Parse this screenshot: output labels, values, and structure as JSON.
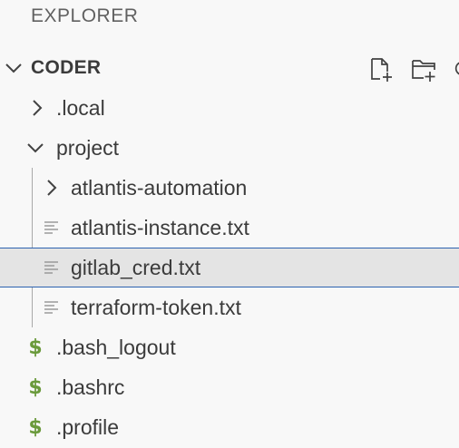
{
  "explorer": {
    "title": "EXPLORER",
    "section": {
      "label": "CODER",
      "actions": [
        {
          "name": "new-file-icon",
          "tooltip": "New File..."
        },
        {
          "name": "new-folder-icon",
          "tooltip": "New Folder..."
        },
        {
          "name": "refresh-icon",
          "tooltip": "Refresh Explorer"
        }
      ]
    },
    "tree": [
      {
        "label": ".local",
        "type": "folder",
        "expanded": false,
        "depth": 0,
        "icon": "chevron-right-icon"
      },
      {
        "label": "project",
        "type": "folder",
        "expanded": true,
        "depth": 0,
        "icon": "chevron-down-icon"
      },
      {
        "label": "atlantis-automation",
        "type": "folder",
        "expanded": false,
        "depth": 1,
        "icon": "chevron-right-icon"
      },
      {
        "label": "atlantis-instance.txt",
        "type": "file",
        "depth": 1,
        "icon": "text-file-icon"
      },
      {
        "label": "gitlab_cred.txt",
        "type": "file",
        "depth": 1,
        "selected": true,
        "icon": "text-file-icon"
      },
      {
        "label": "terraform-token.txt",
        "type": "file",
        "depth": 1,
        "icon": "text-file-icon"
      },
      {
        "label": ".bash_logout",
        "type": "file",
        "depth": 0,
        "icon": "shell-script-icon",
        "glyph": "$"
      },
      {
        "label": ".bashrc",
        "type": "file",
        "depth": 0,
        "icon": "shell-script-icon",
        "glyph": "$"
      },
      {
        "label": ".profile",
        "type": "file",
        "depth": 0,
        "icon": "shell-script-icon",
        "glyph": "$"
      }
    ],
    "colors": {
      "selection_bg": "#e4e4e4",
      "selection_border": "#2c62b0",
      "shell_icon": "#6a9a3b",
      "text": "#3b3b3b"
    }
  }
}
